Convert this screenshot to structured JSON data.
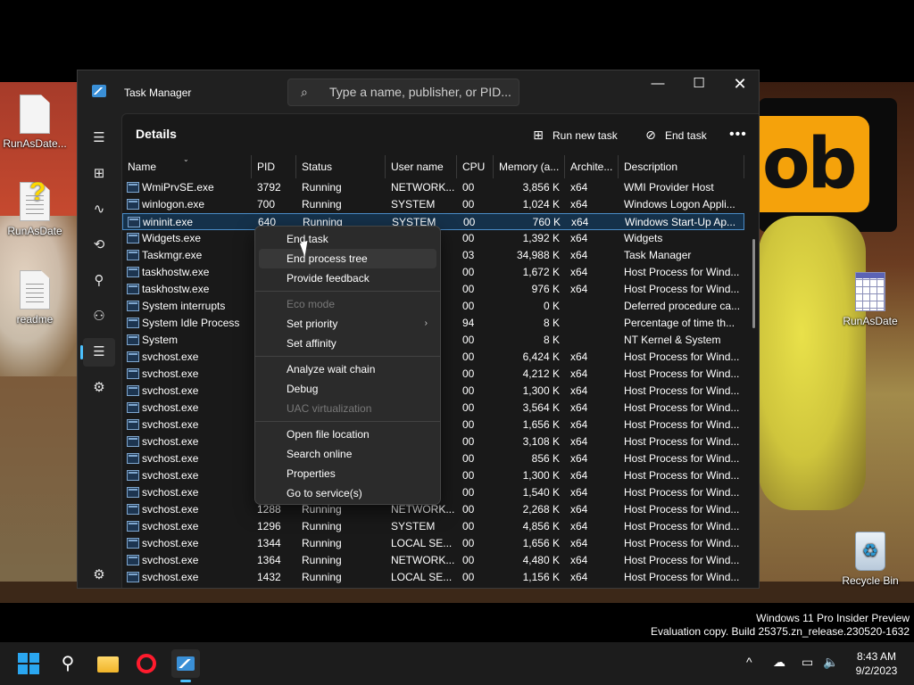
{
  "desktop": {
    "wallpaper_text": "ob",
    "icons": [
      {
        "label": "RunAsDate..."
      },
      {
        "label": "RunAsDate"
      },
      {
        "label": "readme"
      },
      {
        "label": "RunAsDate"
      },
      {
        "label": "Recycle Bin"
      }
    ]
  },
  "window": {
    "title": "Task Manager",
    "search_placeholder": "Type a name, publisher, or PID...",
    "minimize_glyph": "—",
    "maximize_glyph": "☐",
    "close_glyph": "✕"
  },
  "toolbar": {
    "page_title": "Details",
    "run_new_task": "Run new task",
    "end_task": "End task",
    "more": "•••"
  },
  "table": {
    "columns": [
      "Name",
      "PID",
      "Status",
      "User name",
      "CPU",
      "Memory (a...",
      "Archite...",
      "Description"
    ],
    "rows": [
      [
        "WmiPrvSE.exe",
        "3792",
        "Running",
        "NETWORK...",
        "00",
        "3,856 K",
        "x64",
        "WMI Provider Host"
      ],
      [
        "winlogon.exe",
        "700",
        "Running",
        "SYSTEM",
        "00",
        "1,024 K",
        "x64",
        "Windows Logon Appli..."
      ],
      [
        "wininit.exe",
        "640",
        "Running",
        "SYSTEM",
        "00",
        "760 K",
        "x64",
        "Windows Start-Up Ap..."
      ],
      [
        "Widgets.exe",
        "",
        "",
        "",
        "00",
        "1,392 K",
        "x64",
        "Widgets"
      ],
      [
        "Taskmgr.exe",
        "",
        "",
        "",
        "03",
        "34,988 K",
        "x64",
        "Task Manager"
      ],
      [
        "taskhostw.exe",
        "",
        "",
        "",
        "00",
        "1,672 K",
        "x64",
        "Host Process for Wind..."
      ],
      [
        "taskhostw.exe",
        "",
        "",
        "",
        "00",
        "976 K",
        "x64",
        "Host Process for Wind..."
      ],
      [
        "System interrupts",
        "",
        "",
        "",
        "00",
        "0 K",
        "",
        "Deferred procedure ca..."
      ],
      [
        "System Idle Process",
        "",
        "",
        "",
        "94",
        "8 K",
        "",
        "Percentage of time th..."
      ],
      [
        "System",
        "",
        "",
        "",
        "00",
        "8 K",
        "",
        "NT Kernel & System"
      ],
      [
        "svchost.exe",
        "",
        "",
        "",
        "00",
        "6,424 K",
        "x64",
        "Host Process for Wind..."
      ],
      [
        "svchost.exe",
        "",
        "",
        "...",
        "00",
        "4,212 K",
        "x64",
        "Host Process for Wind..."
      ],
      [
        "svchost.exe",
        "",
        "",
        "",
        "00",
        "1,300 K",
        "x64",
        "Host Process for Wind..."
      ],
      [
        "svchost.exe",
        "",
        "",
        "",
        "00",
        "3,564 K",
        "x64",
        "Host Process for Wind..."
      ],
      [
        "svchost.exe",
        "",
        "",
        "",
        "00",
        "1,656 K",
        "x64",
        "Host Process for Wind..."
      ],
      [
        "svchost.exe",
        "",
        "",
        "...",
        "00",
        "3,108 K",
        "x64",
        "Host Process for Wind..."
      ],
      [
        "svchost.exe",
        "",
        "",
        "...",
        "00",
        "856 K",
        "x64",
        "Host Process for Wind..."
      ],
      [
        "svchost.exe",
        "",
        "",
        "...",
        "00",
        "1,300 K",
        "x64",
        "Host Process for Wind..."
      ],
      [
        "svchost.exe",
        "",
        "",
        "...",
        "00",
        "1,540 K",
        "x64",
        "Host Process for Wind..."
      ],
      [
        "svchost.exe",
        "1288",
        "Running",
        "NETWORK...",
        "00",
        "2,268 K",
        "x64",
        "Host Process for Wind..."
      ],
      [
        "svchost.exe",
        "1296",
        "Running",
        "SYSTEM",
        "00",
        "4,856 K",
        "x64",
        "Host Process for Wind..."
      ],
      [
        "svchost.exe",
        "1344",
        "Running",
        "LOCAL SE...",
        "00",
        "1,656 K",
        "x64",
        "Host Process for Wind..."
      ],
      [
        "svchost.exe",
        "1364",
        "Running",
        "NETWORK...",
        "00",
        "4,480 K",
        "x64",
        "Host Process for Wind..."
      ],
      [
        "svchost.exe",
        "1432",
        "Running",
        "LOCAL SE...",
        "00",
        "1,156 K",
        "x64",
        "Host Process for Wind..."
      ]
    ],
    "selected_row": 2
  },
  "context_menu": {
    "items": [
      {
        "label": "End task",
        "enabled": true
      },
      {
        "label": "End process tree",
        "enabled": true
      },
      {
        "label": "Provide feedback",
        "enabled": true
      },
      {
        "label": "Eco mode",
        "enabled": false
      },
      {
        "label": "Set priority",
        "enabled": true,
        "submenu": true
      },
      {
        "label": "Set affinity",
        "enabled": true
      },
      {
        "label": "Analyze wait chain",
        "enabled": true
      },
      {
        "label": "Debug",
        "enabled": true
      },
      {
        "label": "UAC virtualization",
        "enabled": false
      },
      {
        "label": "Open file location",
        "enabled": true
      },
      {
        "label": "Search online",
        "enabled": true
      },
      {
        "label": "Properties",
        "enabled": true
      },
      {
        "label": "Go to service(s)",
        "enabled": true
      }
    ],
    "submenu_arrow": "›"
  },
  "watermark": {
    "line1": "Windows 11 Pro Insider Preview",
    "line2": "Evaluation copy. Build 25375.zn_release.230520-1632"
  },
  "taskbar": {
    "time": "8:43 AM",
    "date": "9/2/2023",
    "chevron": "^"
  },
  "icons": {
    "search": "⌕",
    "hamburger": "☰",
    "nav": [
      "⊞",
      "∿",
      "⟲",
      "⚲",
      "⚇",
      "☰",
      "⚙"
    ],
    "settings": "⚙",
    "run_new_task": "⊞",
    "end_task": "⊘",
    "taskbar_search": "⚲",
    "tray_cloud": "☁",
    "tray_display": "▭",
    "tray_volume": "🔈"
  },
  "colors": {
    "accent": "#4cc2ff",
    "selection": "#15314a",
    "window_bg": "#202020"
  }
}
